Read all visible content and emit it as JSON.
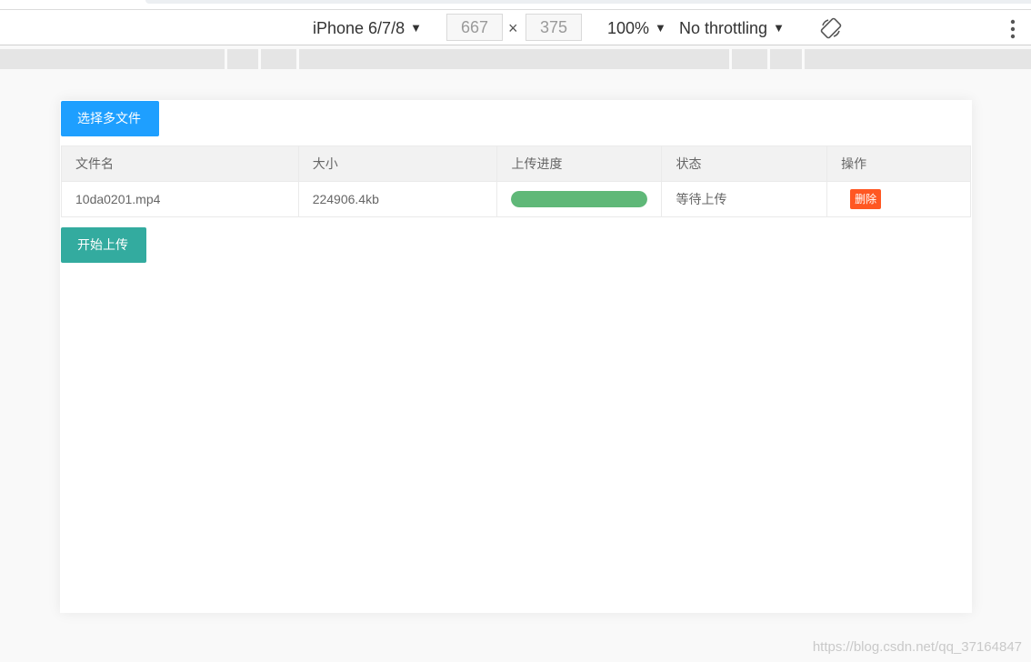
{
  "devtools": {
    "device": "iPhone 6/7/8",
    "width": "667",
    "times": "×",
    "height": "375",
    "zoom": "100%",
    "throttling": "No throttling",
    "arrow": "▼"
  },
  "uploader": {
    "select_button": "选择多文件",
    "start_button": "开始上传",
    "columns": [
      "文件名",
      "大小",
      "上传进度",
      "状态",
      "操作"
    ],
    "rows": [
      {
        "name": "10da0201.mp4",
        "size": "224906.4kb",
        "progress_fraction": 1.0,
        "status": "等待上传",
        "action": "删除"
      }
    ]
  },
  "colors": {
    "select_button": "#1e9fff",
    "start_button": "#33ab9f",
    "progress": "#5fb878",
    "delete_button": "#ff5722"
  },
  "watermark": "https://blog.csdn.net/qq_37164847"
}
